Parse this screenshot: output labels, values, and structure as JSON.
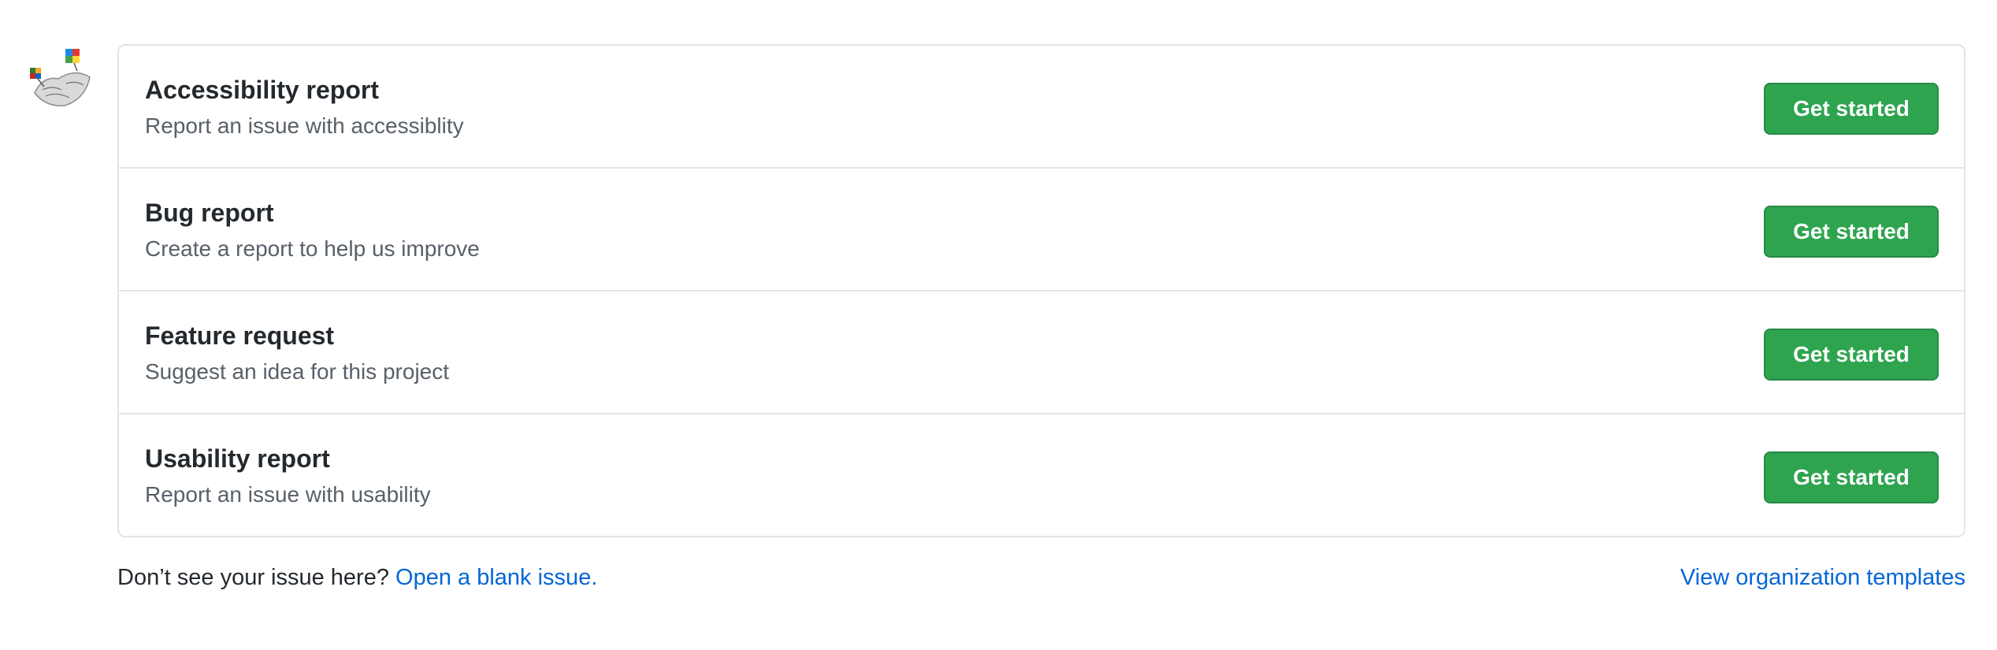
{
  "templates": [
    {
      "title": "Accessibility report",
      "description": "Report an issue with accessiblity",
      "button_label": "Get started"
    },
    {
      "title": "Bug report",
      "description": "Create a report to help us improve",
      "button_label": "Get started"
    },
    {
      "title": "Feature request",
      "description": "Suggest an idea for this project",
      "button_label": "Get started"
    },
    {
      "title": "Usability report",
      "description": "Report an issue with usability",
      "button_label": "Get started"
    }
  ],
  "footer": {
    "prompt": "Don’t see your issue here?",
    "blank_issue_link": "Open a blank issue.",
    "org_templates_link": "View organization templates"
  },
  "colors": {
    "button_green": "#2ea44f",
    "link_blue": "#0366d6",
    "border": "#e1e4e8",
    "muted_text": "#586069"
  },
  "icons": {
    "avatar": "organization-avatar"
  }
}
